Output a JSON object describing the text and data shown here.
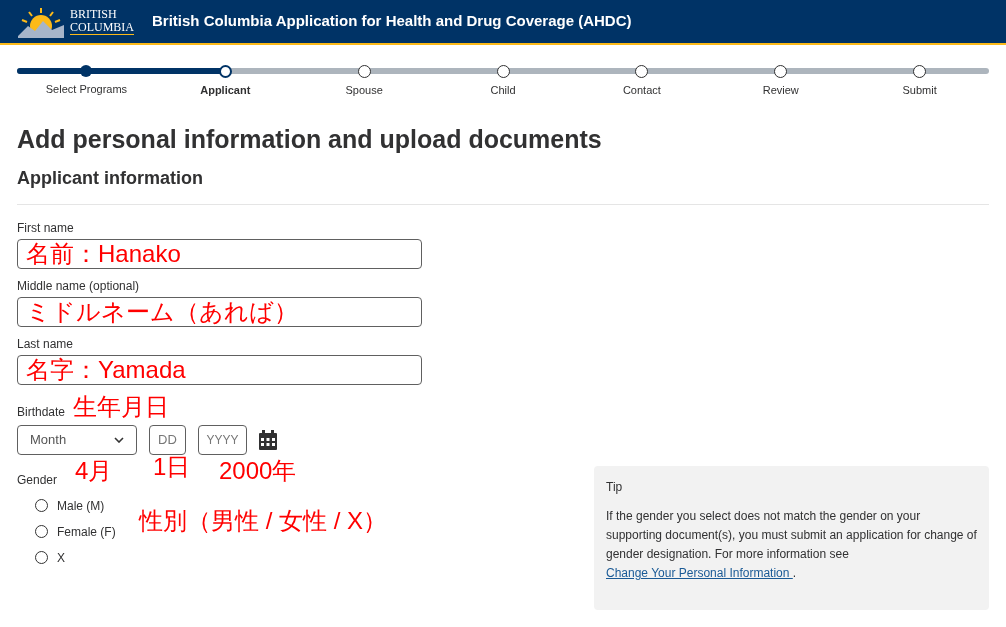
{
  "header": {
    "logo_text": [
      "BRITISH",
      "COLUMBIA"
    ],
    "title": "British Columbia Application for Health and Drug Coverage (AHDC)"
  },
  "steps": [
    {
      "label": "Select Programs",
      "completed": true,
      "selected": false
    },
    {
      "label": "Applicant",
      "completed": false,
      "selected": true
    },
    {
      "label": "Spouse",
      "completed": false,
      "selected": false
    },
    {
      "label": "Child",
      "completed": false,
      "selected": false
    },
    {
      "label": "Contact",
      "completed": false,
      "selected": false
    },
    {
      "label": "Review",
      "completed": false,
      "selected": false
    },
    {
      "label": "Submit",
      "completed": false,
      "selected": false
    }
  ],
  "heading": "Add personal information and upload documents",
  "section_title": "Applicant information",
  "fields": [
    {
      "label": "First name",
      "value": "名前：Hanako"
    },
    {
      "label": "Middle name (optional)",
      "value": "ミドルネーム（あれば）"
    },
    {
      "label": "Last name",
      "value": "名字：Yamada"
    }
  ],
  "birthdate": {
    "label": "Birthdate",
    "annotation": "生年月日",
    "month": {
      "placeholder": "Month",
      "annotation": "4月"
    },
    "day": {
      "placeholder": "DD",
      "annotation": "1日"
    },
    "year": {
      "placeholder": "YYYY",
      "annotation": "2000年"
    }
  },
  "gender": {
    "label": "Gender",
    "annotation": "性別（男性 / 女性 / X）",
    "options": [
      {
        "label": "Male (M)",
        "selected": false
      },
      {
        "label": "Female (F)",
        "selected": false
      },
      {
        "label": "X",
        "selected": false
      }
    ]
  },
  "tip": {
    "title": "Tip",
    "text": "If the gender you select does not match the gender on your supporting document(s), you must submit an application for change of gender designation. For more information see ",
    "link": "Change Your Personal Information ",
    "after": "."
  }
}
